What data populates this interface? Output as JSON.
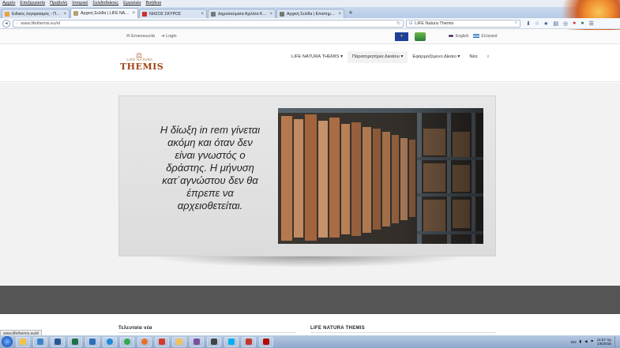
{
  "browser": {
    "menu": [
      "Αρχείο",
      "Επεξεργασία",
      "Προβολή",
      "Ιστορικό",
      "Σελιδοδείκτες",
      "Εργαλεία",
      "Βοήθεια"
    ],
    "tabs": [
      {
        "label": "Ειδικός λογαριασμός - Πα...",
        "favicon_color": "#e8a33a",
        "active": false
      },
      {
        "label": "Αρχική Σελίδα | LIFE NATU...",
        "favicon_color": "#b0a170",
        "active": true
      },
      {
        "label": "ΝΗΣΟΣ ΣΚΥΡΟΣ",
        "favicon_color": "#c9302c",
        "active": false
      },
      {
        "label": "Δημοσιεύματα Αχιλλέα Κουρ...",
        "favicon_color": "#777777",
        "active": false
      },
      {
        "label": "Αρχική Σελίδα | Επιστημ. κέ...",
        "favicon_color": "#777777",
        "active": false
      }
    ],
    "new_tab": "+",
    "url": "www.lifethemis.eu/el",
    "search_query": "LIFE Natura Themis"
  },
  "site": {
    "topbar": {
      "contact": "Επικοινωνία",
      "login": "Login",
      "lang_en": "English",
      "lang_el": "Ελληνικά"
    },
    "logo": {
      "small": "LIFE NATURA",
      "big": "THEMIS"
    },
    "nav": [
      {
        "label": "LIFE NATURA THEMIS ▾"
      },
      {
        "label": "Παρατηρητήρια Δικαίου ▾"
      },
      {
        "label": "Εφαρμοζόμενο Δίκαιο ▾"
      },
      {
        "label": "Νέα"
      }
    ],
    "hero": {
      "quote": "Η δίωξη in rem γίνεται\nακόμη και όταν δεν\nείναι γνωστός ο\nδράστης. Η μήνυση\nκατ΄αγνώστου δεν θα\nέπρεπε να\nαρχειοθετείται."
    },
    "footer": {
      "latest_news": "Τελευταία νέα",
      "project": "LIFE NATURA THEMIS"
    }
  },
  "status_url": "www.lifethemis.eu/el",
  "taskbar": {
    "lang": "EN",
    "time": "11:57 πμ",
    "date": "1/6/2016"
  }
}
